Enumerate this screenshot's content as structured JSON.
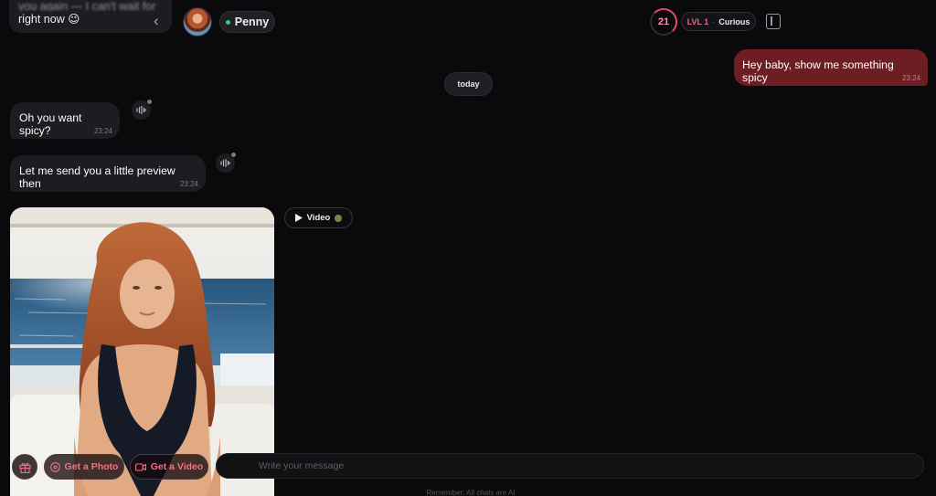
{
  "header": {
    "previous_message_line1": "you again — I can't wait for you to see me",
    "previous_message_line2": "right now 😉",
    "back_icon": "chevron-left-icon",
    "character_name": "Penny",
    "online_status_color": "#30d27a",
    "score": "21",
    "level_label": "LVL 1",
    "level_separator": "·",
    "relationship_stage": "Curious",
    "panel_icon": "sidebar-toggle-icon"
  },
  "messages": [
    {
      "direction": "outgoing",
      "text": "Hey baby, show me something spicy",
      "time": "23:24"
    },
    {
      "direction": "date",
      "text": "today"
    },
    {
      "direction": "incoming",
      "text": "Oh you want spicy?",
      "time": "23:24",
      "icon": "voice-play-icon"
    },
    {
      "direction": "incoming",
      "text": "Let me send you a little preview then",
      "time": "23:24",
      "icon": "voice-play-icon"
    }
  ],
  "media": {
    "video_button_label": "Video",
    "video_icon": "play-icon",
    "coin_icon": "coin-icon"
  },
  "composer": {
    "gift_icon": "gift-icon",
    "photo_button_label": "Get a Photo",
    "photo_icon": "image-icon",
    "video_button_label": "Get a Video",
    "video_icon": "video-camera-icon",
    "placeholder": "Write your message",
    "footer_note": "Remember: All chats are AI"
  },
  "colors": {
    "background": "#0a0a0c",
    "outgoing_bubble": "#6e1d22",
    "incoming_bubble": "#1c1c21",
    "accent": "#ff6b86"
  }
}
